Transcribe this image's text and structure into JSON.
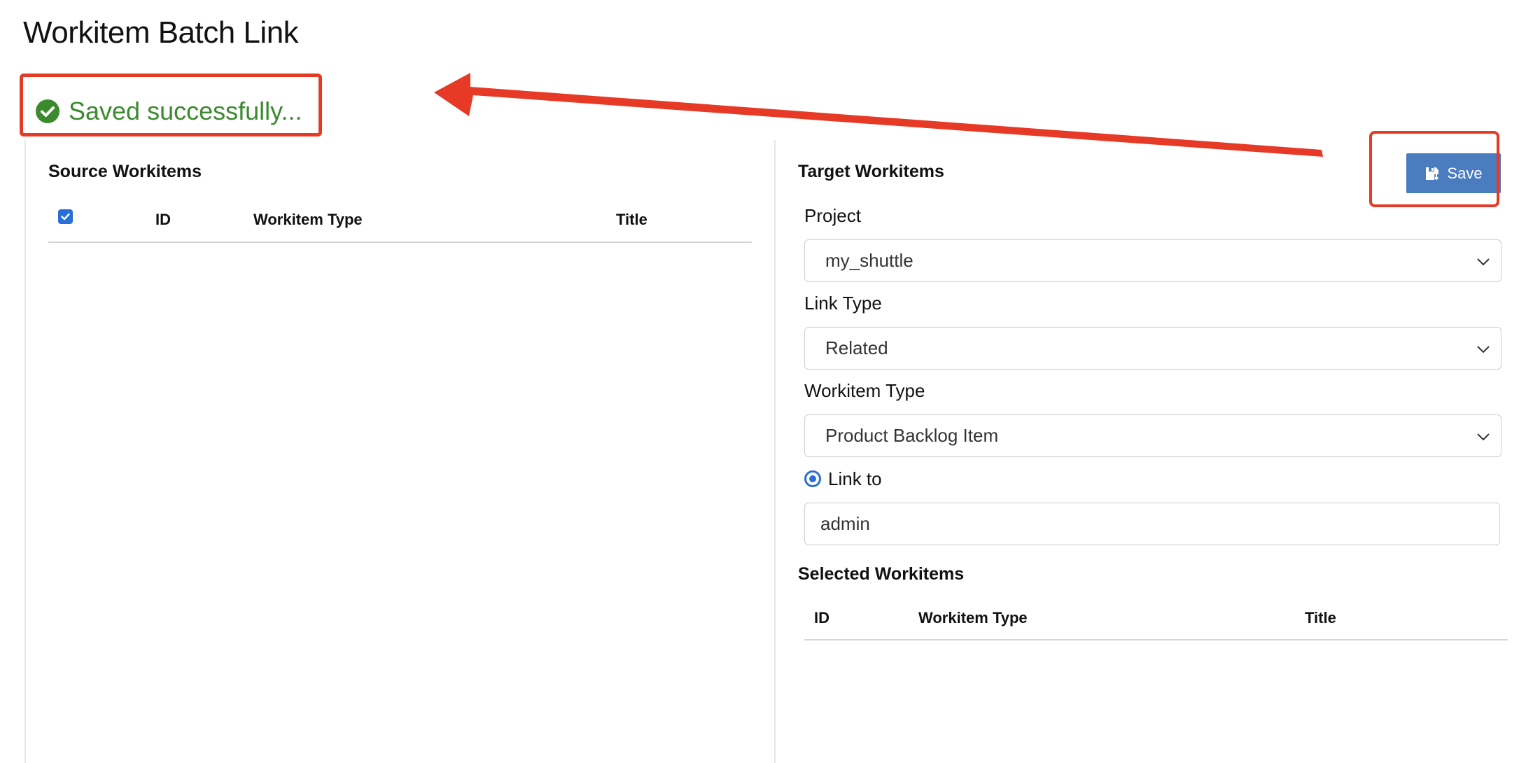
{
  "page": {
    "title": "Workitem Batch Link"
  },
  "status": {
    "message": "Saved successfully...",
    "icon": "check-circle-icon",
    "color": "#3b8a2e"
  },
  "annotation": {
    "color": "#e63a27"
  },
  "source": {
    "title": "Source Workitems",
    "select_all_checked": true,
    "columns": [
      "ID",
      "Workitem Type",
      "Title"
    ],
    "rows": []
  },
  "target": {
    "title": "Target Workitems",
    "save_label": "Save",
    "save_icon": "save-icon",
    "project": {
      "label": "Project",
      "value": "my_shuttle"
    },
    "link_type": {
      "label": "Link Type",
      "value": "Related"
    },
    "workitem_type": {
      "label": "Workitem Type",
      "value": "Product Backlog Item"
    },
    "link_to": {
      "label": "Link to",
      "checked": true,
      "value": "admin"
    },
    "selected": {
      "title": "Selected Workitems",
      "columns": [
        "ID",
        "Workitem Type",
        "Title"
      ],
      "rows": []
    }
  },
  "colors": {
    "accent": "#2a6fd6",
    "button": "#4a7cc0"
  }
}
